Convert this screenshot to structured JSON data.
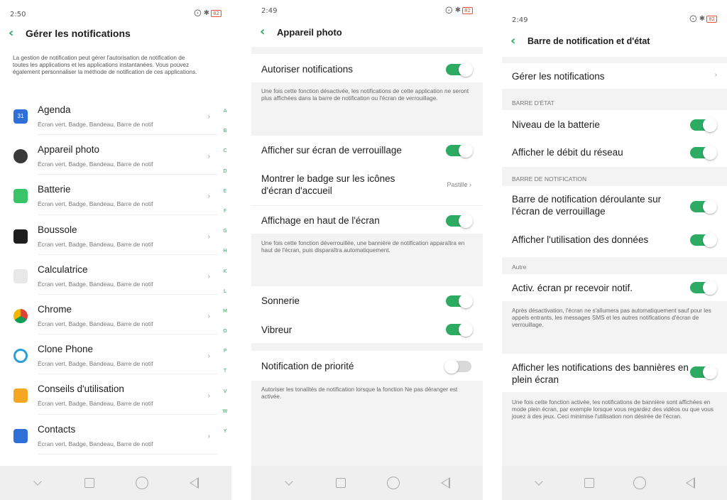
{
  "panel1": {
    "status": {
      "time": "2:50",
      "right_icons": "⨀ ✱",
      "battery": "82"
    },
    "title": "Gérer les notifications",
    "intro": "La gestion de notification peut gérer l'autorisation de notification de toutes les applications et les applications instantanées. Vous pouvez également personnaliser la méthode de notification de ces applications.",
    "apps": [
      {
        "name": "Agenda",
        "sub": "Écran vert, Badge, Bandeau, Barre de notif",
        "icon_color": "#2f6fd8",
        "icon": "calendar-icon",
        "glyph": "31"
      },
      {
        "name": "Appareil photo",
        "sub": "Écran vert, Badge, Bandeau, Barre de notif",
        "icon_color": "#3a3a3a",
        "icon": "camera-icon",
        "glyph": ""
      },
      {
        "name": "Batterie",
        "sub": "Écran vert, Badge, Bandeau, Barre de notif",
        "icon_color": "#39c46a",
        "icon": "battery-icon",
        "glyph": ""
      },
      {
        "name": "Boussole",
        "sub": "Écran vert, Badge, Bandeau, Barre de notif",
        "icon_color": "#1e1e1e",
        "icon": "compass-icon",
        "glyph": ""
      },
      {
        "name": "Calculatrice",
        "sub": "Écran vert, Badge, Bandeau, Barre de notif",
        "icon_color": "#e8e8e8",
        "icon": "calculator-icon",
        "glyph": ""
      },
      {
        "name": "Chrome",
        "sub": "Écran vert, Badge, Bandeau, Barre de notif",
        "icon_color": "#db4437",
        "icon": "chrome-icon",
        "glyph": ""
      },
      {
        "name": "Clone Phone",
        "sub": "Écran vert, Badge, Bandeau, Barre de notif",
        "icon_color": "#ffffff",
        "icon": "clone-phone-icon",
        "glyph": ""
      },
      {
        "name": "Conseils d'utilisation",
        "sub": "Écran vert, Badge, Bandeau, Barre de notif",
        "icon_color": "#f5a623",
        "icon": "tips-icon",
        "glyph": ""
      },
      {
        "name": "Contacts",
        "sub": "Écran vert, Badge, Bandeau, Barre de notif",
        "icon_color": "#2f6fd8",
        "icon": "contacts-icon",
        "glyph": ""
      }
    ],
    "index_letters": [
      "A",
      "B",
      "C",
      "D",
      "E",
      "F",
      "G",
      "H",
      "K",
      "L",
      "M",
      "O",
      "P",
      "T",
      "V",
      "W",
      "Y"
    ]
  },
  "panel2": {
    "status": {
      "time": "2:49",
      "right_icons": "⨀ ✱",
      "battery": "82"
    },
    "title": "Appareil photo",
    "rows": {
      "autoriser": "Autoriser notifications",
      "autoriser_note": "Une fois cette fonction désactivée, les notifications de cette application ne seront plus affichées dans la barre de notification ou l'écran de verrouillage.",
      "verrouillage": "Afficher sur écran de verrouillage",
      "badge": "Montrer le badge sur les icônes d'écran d'accueil",
      "badge_value": "Pastille",
      "haut": "Affichage en haut de l'écran",
      "haut_note": "Une fois cette fonction déverrouillée, une bannière de notification apparaîtra en haut de l'écran, puis disparaîtra automatiquement.",
      "sonnerie": "Sonnerie",
      "vibreur": "Vibreur",
      "priorite": "Notification de priorité",
      "priorite_note": "Autoriser les tonalités de notification lorsque la fonction Ne pas déranger est activée."
    }
  },
  "panel3": {
    "status": {
      "time": "2:49",
      "right_icons": "⨀ ✱",
      "battery": "82"
    },
    "title": "Barre de notification et d'état",
    "rows": {
      "gerer": "Gérer les notifications",
      "section_etat": "BARRE D'ÉTAT",
      "batterie": "Niveau de la batterie",
      "debit": "Afficher le débit du réseau",
      "section_notif": "BARRE DE NOTIFICATION",
      "deroulante": "Barre de notification déroulante sur l'écran de verrouillage",
      "donnees": "Afficher l'utilisation des données",
      "section_autre": "Autre",
      "activ": "Activ. écran pr recevoir notif.",
      "activ_note": "Après désactivation, l'écran ne s'allumera pas automatiquement sauf pour les appels entrants, les messages SMS et les autres notifications d'écran de verrouillage.",
      "bannieres": "Afficher les notifications des bannières en plein écran",
      "bannieres_note": "Une fois cette fonction activée, les notifications de bannière sont affichées en mode plein écran, par exemple lorsque vous regardez des vidéos ou que vous jouez à des jeux. Ceci minimise l'utilisation non désirée de l'écran."
    }
  },
  "colors": {
    "accent": "#2dab62",
    "toggle_off": "#d9d9d9",
    "section_gray": "#f3f3f3"
  }
}
